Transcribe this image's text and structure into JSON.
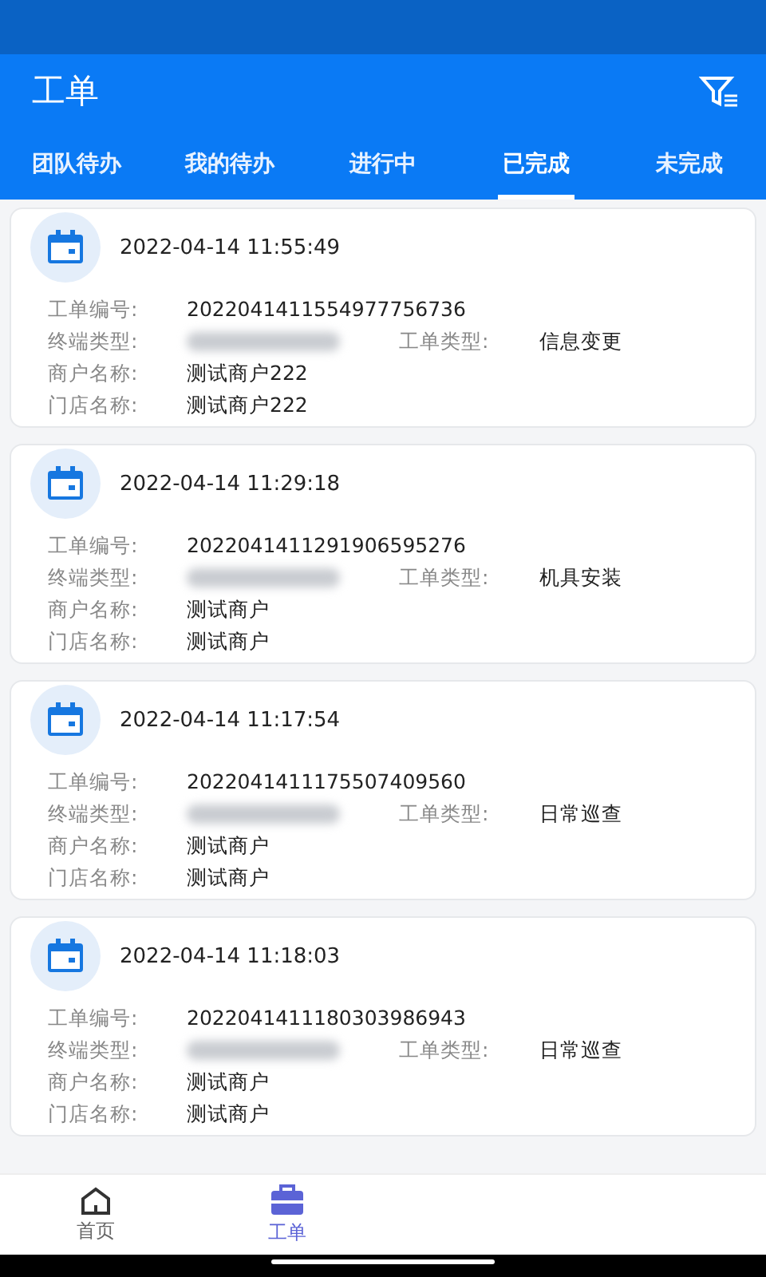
{
  "header": {
    "title": "工单"
  },
  "tabs": [
    {
      "label": "团队待办",
      "selected": false
    },
    {
      "label": "我的待办",
      "selected": false
    },
    {
      "label": "进行中",
      "selected": false
    },
    {
      "label": "已完成",
      "selected": true
    },
    {
      "label": "未完成",
      "selected": false
    }
  ],
  "orders": [
    {
      "time": "2022-04-14 11:55:49",
      "fields": [
        {
          "label": "工单编号:",
          "value": "2022041411554977756736"
        },
        {
          "label": "终端类型:",
          "blurred": true
        },
        {
          "label": "工单类型:",
          "value": "信息变更"
        },
        {
          "label": "商户名称:",
          "value": "测试商户222"
        },
        {
          "label": "门店名称:",
          "value": "测试商户222"
        }
      ]
    },
    {
      "time": "2022-04-14 11:29:18",
      "fields": [
        {
          "label": "工单编号:",
          "value": "2022041411291906595276"
        },
        {
          "label": "终端类型:",
          "blurred": true
        },
        {
          "label": "工单类型:",
          "value": "机具安装"
        },
        {
          "label": "商户名称:",
          "value": "测试商户"
        },
        {
          "label": "门店名称:",
          "value": "测试商户"
        }
      ]
    },
    {
      "time": "2022-04-14 11:17:54",
      "fields": [
        {
          "label": "工单编号:",
          "value": "2022041411175507409560"
        },
        {
          "label": "终端类型:",
          "blurred": true
        },
        {
          "label": "工单类型:",
          "value": "日常巡查"
        },
        {
          "label": "商户名称:",
          "value": "测试商户"
        },
        {
          "label": "门店名称:",
          "value": "测试商户"
        }
      ]
    },
    {
      "time": "2022-04-14 11:18:03",
      "fields": [
        {
          "label": "工单编号:",
          "value": "2022041411180303986943"
        },
        {
          "label": "终端类型:",
          "blurred": true
        },
        {
          "label": "工单类型:",
          "value": "日常巡查"
        },
        {
          "label": "商户名称:",
          "value": "测试商户"
        },
        {
          "label": "门店名称:",
          "value": "测试商户"
        }
      ]
    }
  ],
  "nav": [
    {
      "label": "首页",
      "selected": false
    },
    {
      "label": "工单",
      "selected": true
    }
  ]
}
